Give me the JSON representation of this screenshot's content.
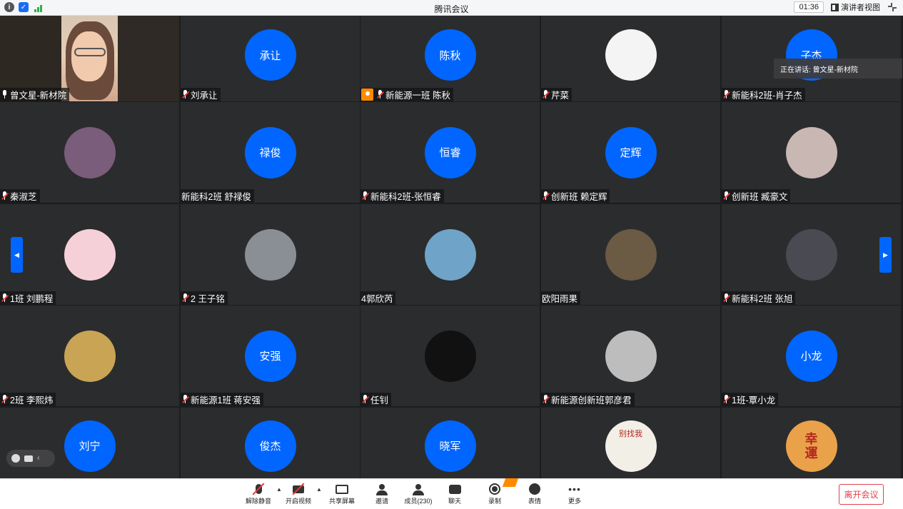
{
  "window": {
    "title": "腾讯会议",
    "timer": "01:36",
    "view_mode_label": "演讲者视图"
  },
  "speaker_popup": "正在讲话: 曾文星-新材院",
  "participants": [
    {
      "name": "曾文星-新材院",
      "avatar_text": "",
      "mic": "on",
      "video": true,
      "host": false
    },
    {
      "name": "刘承让",
      "avatar_text": "承让",
      "mic": "muted",
      "host": false
    },
    {
      "name": "新能源一班 陈秋",
      "avatar_text": "陈秋",
      "mic": "muted",
      "host": true
    },
    {
      "name": "芹菜",
      "avatar_text": "",
      "avatar_image": "rabbit-cartoon",
      "mic": "muted",
      "host": false
    },
    {
      "name": "新能科2班-肖子杰",
      "avatar_text": "子杰",
      "mic": "muted",
      "host": false
    },
    {
      "name": "秦淑芝",
      "avatar_text": "",
      "avatar_image": "alice-cartoon",
      "mic": "muted",
      "host": false
    },
    {
      "name": "新能科2班  舒禄俊",
      "avatar_text": "禄俊",
      "mic": "none",
      "host": false
    },
    {
      "name": "新能科2班-张恒睿",
      "avatar_text": "恒睿",
      "mic": "muted",
      "host": false
    },
    {
      "name": "创新班 赖定辉",
      "avatar_text": "定辉",
      "mic": "muted",
      "host": false
    },
    {
      "name": "创新班  臧豪文",
      "avatar_text": "",
      "avatar_image": "kittens-photo",
      "mic": "muted",
      "host": false
    },
    {
      "name": "1班 刘鹏程",
      "avatar_text": "",
      "avatar_image": "spongebob-cartoon",
      "mic": "muted",
      "host": false
    },
    {
      "name": "2  王子铭",
      "avatar_text": "",
      "avatar_image": "jet-photo",
      "mic": "muted",
      "host": false
    },
    {
      "name": "4郭欣芮",
      "avatar_text": "",
      "avatar_image": "crayon-shinchan",
      "mic": "none",
      "host": false
    },
    {
      "name": "欧阳雨果",
      "avatar_text": "",
      "avatar_image": "dog-photo",
      "mic": "none",
      "host": false
    },
    {
      "name": "新能科2班 张旭",
      "avatar_text": "",
      "avatar_image": "tom-cat-cartoon",
      "mic": "muted",
      "host": false
    },
    {
      "name": "2班 李熙炜",
      "avatar_text": "",
      "avatar_image": "rabbit-photo",
      "mic": "muted",
      "host": false
    },
    {
      "name": "新能源1班 蒋安强",
      "avatar_text": "安强",
      "mic": "muted",
      "host": false
    },
    {
      "name": "任钊",
      "avatar_text": "",
      "avatar_image": "dark-photo",
      "mic": "muted",
      "host": false
    },
    {
      "name": "新能源创新班郭彦君",
      "avatar_text": "",
      "avatar_image": "street-photo",
      "mic": "muted",
      "host": false
    },
    {
      "name": "1班-覃小龙",
      "avatar_text": "小龙",
      "mic": "muted",
      "host": false
    },
    {
      "name": "",
      "avatar_text": "刘宁",
      "mic": "none",
      "host": false
    },
    {
      "name": "",
      "avatar_text": "俊杰",
      "mic": "none",
      "host": false
    },
    {
      "name": "",
      "avatar_text": "晓军",
      "mic": "none",
      "host": false
    },
    {
      "name": "",
      "avatar_text": "",
      "avatar_image": "meme-sticker",
      "avatar_caption": "别找我",
      "mic": "none",
      "host": false
    },
    {
      "name": "",
      "avatar_text": "幸運",
      "avatar_image": "lucky-badge",
      "mic": "none",
      "host": false
    }
  ],
  "toolbar": {
    "unmute_label": "解除静音",
    "video_label": "开启视频",
    "share_label": "共享屏幕",
    "invite_label": "邀请",
    "members_label": "成员(230)",
    "chat_label": "聊天",
    "record_label": "录制",
    "reaction_label": "表情",
    "more_label": "更多",
    "leave_label": "离开会议"
  },
  "colors": {
    "accent": "#0066ff",
    "tile_bg": "#2b2c2e",
    "grid_bg": "#1c1d1f",
    "speaking_border": "#2bb24c",
    "leave_red": "#e0424b",
    "host_badge": "#ff8a00"
  }
}
